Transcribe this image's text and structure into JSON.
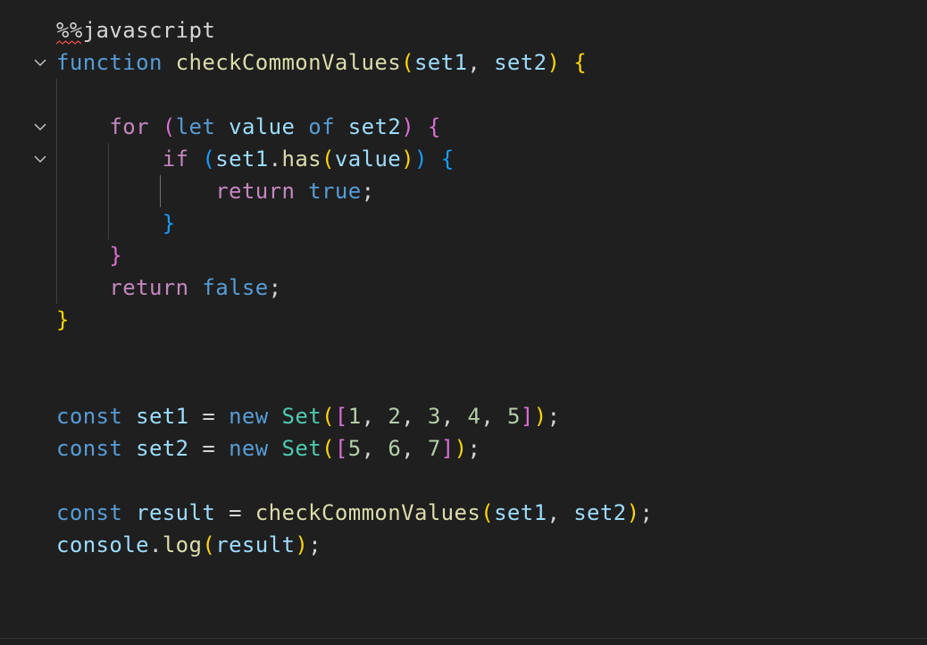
{
  "cell": {
    "magic": "%%javascript",
    "lines": [
      "function checkCommonValues(set1, set2) {",
      "",
      "    for (let value of set2) {",
      "        if (set1.has(value)) {",
      "            return true;",
      "        }",
      "    }",
      "    return false;",
      "}",
      "",
      "",
      "const set1 = new Set([1, 2, 3, 4, 5]);",
      "const set2 = new Set([5, 6, 7]);",
      "",
      "const result = checkCommonValues(set1, set2);",
      "console.log(result);"
    ]
  },
  "tokens": {
    "magic": "%%javascript",
    "kw_function": "function",
    "fn_check": "checkCommonValues",
    "var_set1": "set1",
    "var_set2": "set2",
    "kw_for": "for",
    "kw_let": "let",
    "var_value": "value",
    "kw_of": "of",
    "kw_if": "if",
    "fn_has": "has",
    "kw_return": "return",
    "kw_true": "true",
    "kw_false": "false",
    "kw_const": "const",
    "kw_new": "new",
    "cls_set": "Set",
    "var_result": "result",
    "var_console": "console",
    "fn_log": "log",
    "nums_set1": [
      "1",
      "2",
      "3",
      "4",
      "5"
    ],
    "nums_set2": [
      "5",
      "6",
      "7"
    ]
  },
  "theme": {
    "background": "#1f1f1f",
    "keyword_blue": "#569cd6",
    "keyword_pink": "#c586c0",
    "function": "#dcdcaa",
    "variable": "#9cdcfe",
    "class": "#4ec9b0",
    "number": "#b5cea8",
    "bracket_level1": "#ffd700",
    "bracket_level2": "#da70d6",
    "bracket_level3": "#179fff"
  },
  "icons": {
    "fold": "chevron-down-icon",
    "error": "squiggle-underline"
  }
}
